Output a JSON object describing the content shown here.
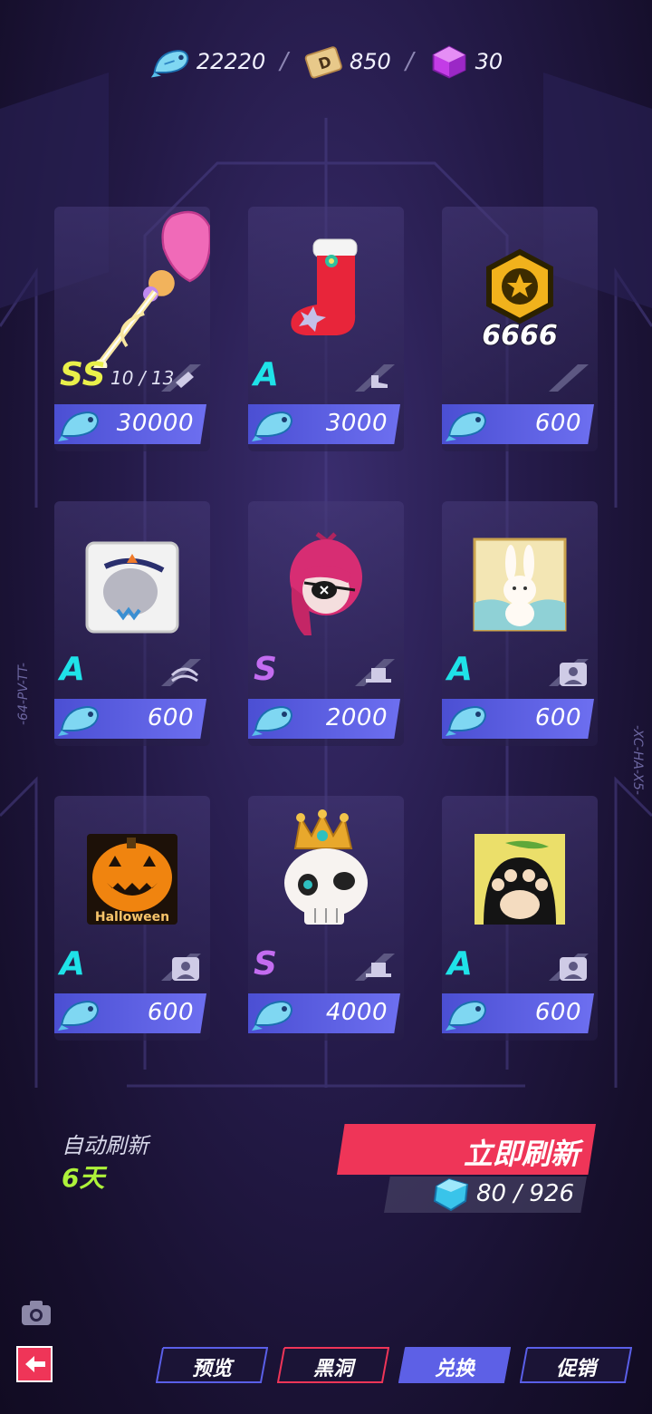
{
  "currencies": {
    "fish": "22220",
    "coupon": "850",
    "cube": "30",
    "coupon_icon_letter": "D"
  },
  "items": [
    {
      "name": "ss-staff",
      "grade": "SS",
      "count": "10 / 13",
      "slot": "weapon-slot-icon",
      "price": "30000",
      "thumb": "heart-staff-icon"
    },
    {
      "name": "a-boot",
      "grade": "A",
      "count": "",
      "slot": "shoe-slot-icon",
      "price": "3000",
      "thumb": "red-boot-icon"
    },
    {
      "name": "coin-pack",
      "grade": "",
      "count": "",
      "slot": "empty-slot",
      "price": "600",
      "thumb": "star-coin-icon",
      "thumb_label": "6666"
    },
    {
      "name": "a-eyes",
      "grade": "A",
      "count": "",
      "slot": "eyes-slot-icon",
      "price": "600",
      "thumb": "eyes-card-icon"
    },
    {
      "name": "s-hair",
      "grade": "S",
      "count": "",
      "slot": "hat-slot-icon",
      "price": "2000",
      "thumb": "pink-hair-icon"
    },
    {
      "name": "a-rabbit",
      "grade": "A",
      "count": "",
      "slot": "avatar-slot-icon",
      "price": "600",
      "thumb": "rabbit-card-icon"
    },
    {
      "name": "a-halloween",
      "grade": "A",
      "count": "",
      "slot": "avatar-slot-icon",
      "price": "600",
      "thumb": "pumpkin-card-icon",
      "thumb_label": "Halloween"
    },
    {
      "name": "s-skull",
      "grade": "S",
      "count": "",
      "slot": "hat-slot-icon",
      "price": "4000",
      "thumb": "skull-crown-icon"
    },
    {
      "name": "a-paw",
      "grade": "A",
      "count": "",
      "slot": "avatar-slot-icon",
      "price": "600",
      "thumb": "paw-card-icon"
    }
  ],
  "side_labels": {
    "left": "-64-PV-TT-",
    "right": "-XC-HA-X5-"
  },
  "refresh": {
    "auto_label": "自动刷新",
    "auto_days": "6天",
    "button_label": "立即刷新",
    "cost": "80 / 926"
  },
  "tabs": [
    {
      "label": "预览",
      "border": "#5a5fe8"
    },
    {
      "label": "黑洞",
      "border": "#ef3558"
    },
    {
      "label": "兑换",
      "border": "#5d60e6",
      "active": true
    },
    {
      "label": "促销",
      "border": "#5a5fe8"
    }
  ],
  "colors": {
    "accent": "#ef3558",
    "price_bar": "#5b5fe4",
    "grade_a": "#1fe2e8",
    "grade_s": "#c36cf0",
    "grade_ss": "#e9f04a",
    "days": "#aef23a"
  }
}
